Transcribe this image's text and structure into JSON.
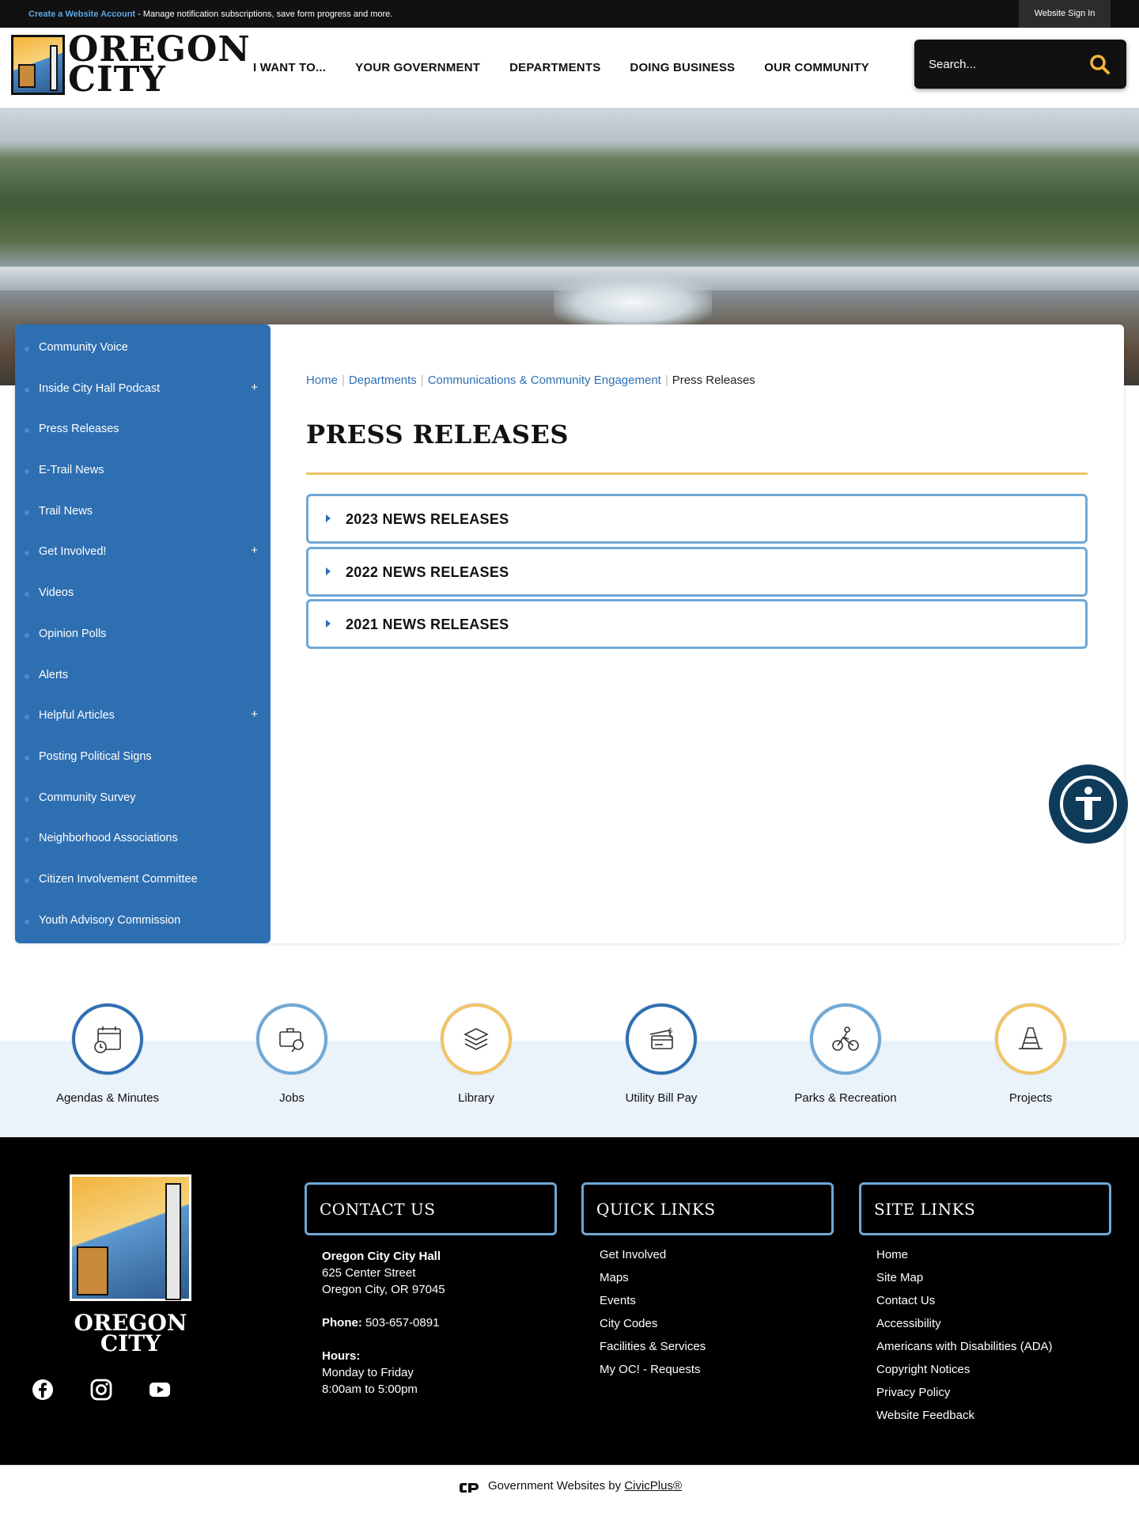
{
  "topbar": {
    "create_account_link": "Create a Website Account",
    "create_account_text": " - Manage notification subscriptions, save form progress and more.",
    "signin": "Website Sign In"
  },
  "logo": {
    "line1": "OREGON",
    "line2": "CITY"
  },
  "nav": [
    "I WANT TO...",
    "YOUR GOVERNMENT",
    "DEPARTMENTS",
    "DOING BUSINESS",
    "OUR COMMUNITY"
  ],
  "search": {
    "placeholder": "Search..."
  },
  "sidebar": {
    "items": [
      {
        "label": "Community Voice",
        "expand": ""
      },
      {
        "label": "Inside City Hall Podcast",
        "expand": "+"
      },
      {
        "label": "Press Releases",
        "expand": ""
      },
      {
        "label": "E-Trail News",
        "expand": ""
      },
      {
        "label": "Trail News",
        "expand": ""
      },
      {
        "label": "Get Involved!",
        "expand": "+"
      },
      {
        "label": "Videos",
        "expand": ""
      },
      {
        "label": "Opinion Polls",
        "expand": ""
      },
      {
        "label": "Alerts",
        "expand": ""
      },
      {
        "label": "Helpful Articles",
        "expand": "+"
      },
      {
        "label": "Posting Political Signs",
        "expand": ""
      },
      {
        "label": "Community Survey",
        "expand": ""
      },
      {
        "label": "Neighborhood Associations",
        "expand": ""
      },
      {
        "label": "Citizen Involvement Committee",
        "expand": ""
      },
      {
        "label": "Youth Advisory Commission",
        "expand": ""
      }
    ]
  },
  "breadcrumb": {
    "home": "Home",
    "departments": "Departments",
    "comms": "Communications & Community Engagement",
    "current": "Press Releases"
  },
  "page_title": "PRESS RELEASES",
  "accordions": [
    "2023 NEWS RELEASES",
    "2022 NEWS RELEASES",
    "2021 NEWS RELEASES"
  ],
  "quick_links": [
    {
      "label": "Agendas & Minutes",
      "color": "#2e6fb2"
    },
    {
      "label": "Jobs",
      "color": "#6fa8d6"
    },
    {
      "label": "Library",
      "color": "#f2c464"
    },
    {
      "label": "Utility Bill Pay",
      "color": "#2e6fb2"
    },
    {
      "label": "Parks & Recreation",
      "color": "#6fa8d6"
    },
    {
      "label": "Projects",
      "color": "#f2c464"
    }
  ],
  "footer": {
    "logo_line1": "OREGON",
    "logo_line2": "CITY",
    "contact_heading": "CONTACT US",
    "quick_heading": "QUICK LINKS",
    "site_heading": "SITE LINKS",
    "contact": {
      "name": "Oregon City City Hall",
      "street": "625 Center Street",
      "city": "Oregon City, OR 97045",
      "phone_label": "Phone:",
      "phone": " 503-657-0891",
      "hours_label": "Hours:",
      "days": "Monday to Friday",
      "time": "8:00am to 5:00pm"
    },
    "quick_links": [
      "Get Involved",
      "Maps",
      "Events",
      "City Codes",
      "Facilities & Services",
      "My OC! - Requests"
    ],
    "site_links": [
      "Home",
      "Site Map",
      "Contact Us",
      "Accessibility",
      "Americans with Disabilities (ADA)",
      "Copyright Notices",
      "Privacy Policy",
      "Website Feedback"
    ]
  },
  "powered_by": {
    "text": "Government Websites by ",
    "link": "CivicPlus®"
  },
  "colors": {
    "sidebar": "#2e6fb2",
    "accent_gold": "#f2c464",
    "accordion_border": "#6fa8d6",
    "footer_bg": "#000000"
  }
}
